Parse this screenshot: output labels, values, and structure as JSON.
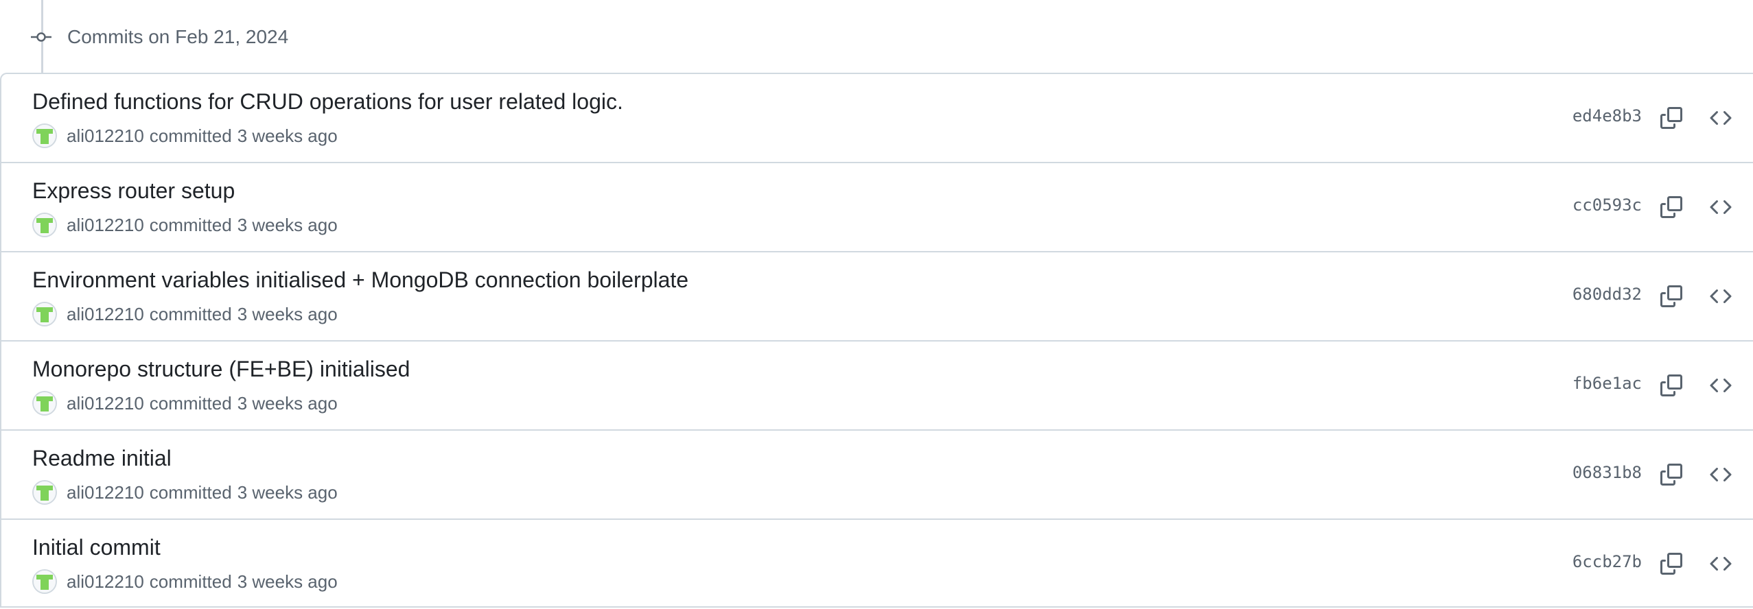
{
  "timeline": {
    "date_label": "Commits on Feb 21, 2024"
  },
  "commits": [
    {
      "message": "Defined functions for CRUD operations for user related logic.",
      "author": "ali012210",
      "action": "committed",
      "time": "3 weeks ago",
      "sha": "ed4e8b3"
    },
    {
      "message": "Express router setup",
      "author": "ali012210",
      "action": "committed",
      "time": "3 weeks ago",
      "sha": "cc0593c"
    },
    {
      "message": "Environment variables initialised + MongoDB connection boilerplate",
      "author": "ali012210",
      "action": "committed",
      "time": "3 weeks ago",
      "sha": "680dd32"
    },
    {
      "message": "Monorepo structure (FE+BE) initialised",
      "author": "ali012210",
      "action": "committed",
      "time": "3 weeks ago",
      "sha": "fb6e1ac"
    },
    {
      "message": "Readme initial",
      "author": "ali012210",
      "action": "committed",
      "time": "3 weeks ago",
      "sha": "06831b8"
    },
    {
      "message": "Initial commit",
      "author": "ali012210",
      "action": "committed",
      "time": "3 weeks ago",
      "sha": "6ccb27b"
    }
  ],
  "icons": {
    "timeline": "git-commit-icon",
    "copy": "copy-icon",
    "browse": "code-icon"
  },
  "colors": {
    "avatar_green": "#7fd35a",
    "muted_text": "#59636e",
    "border": "#d1d9e0"
  }
}
